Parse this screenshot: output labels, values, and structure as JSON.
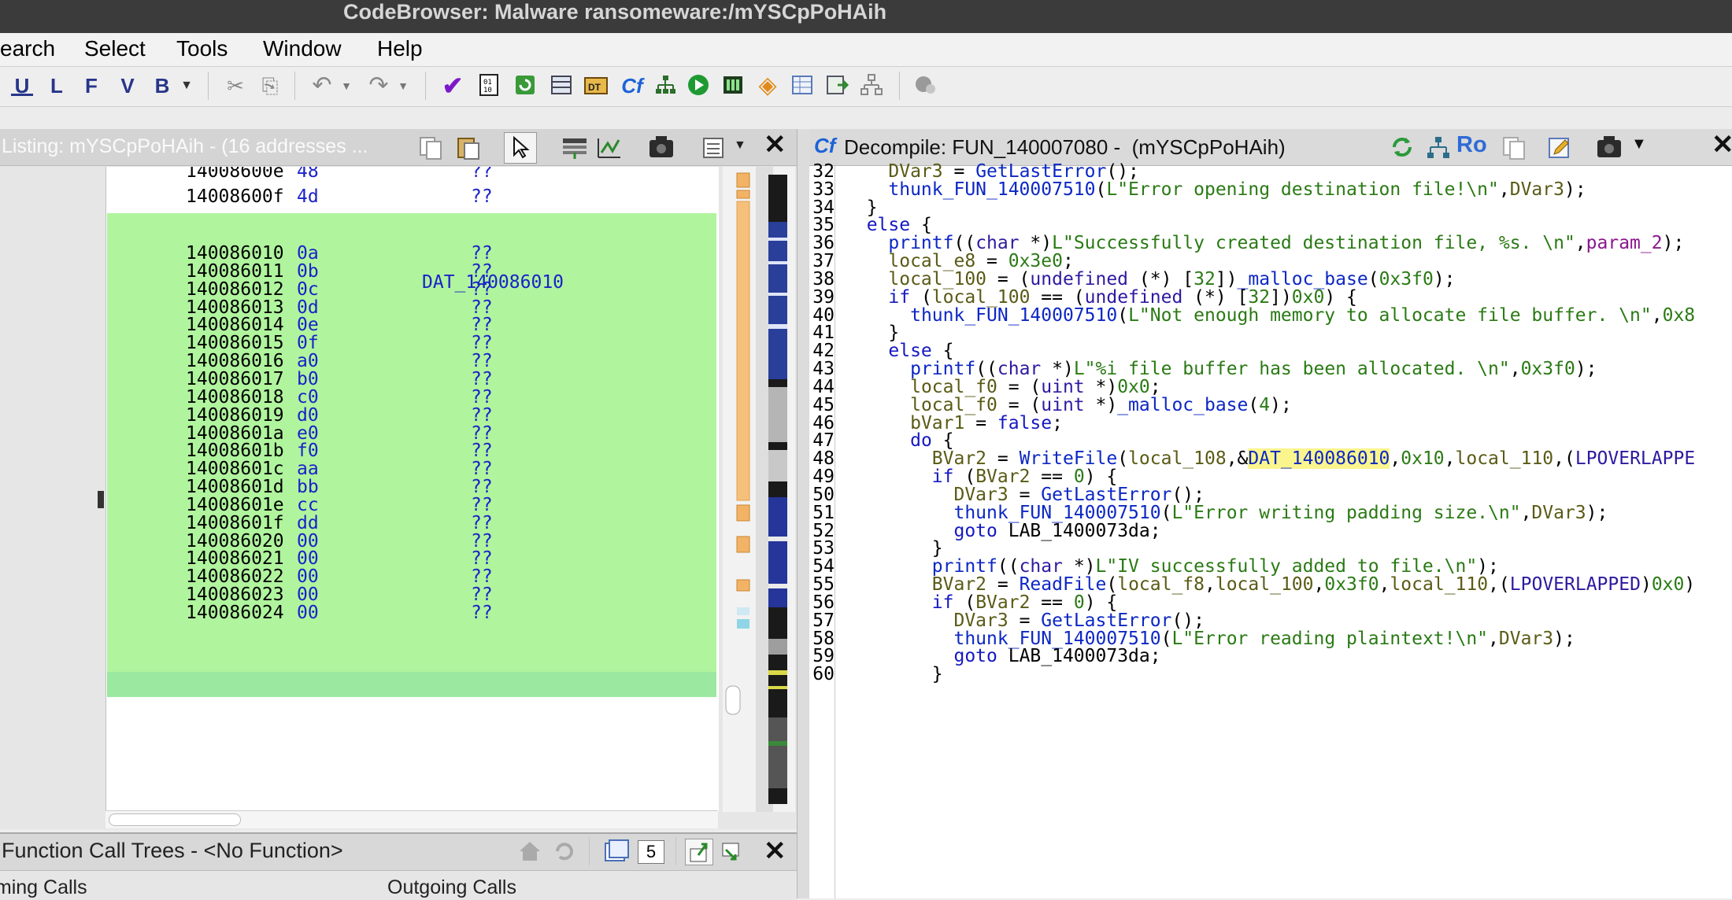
{
  "window": {
    "title": "CodeBrowser: Malware ransomeware:/mYSCpPoHAih"
  },
  "menu": [
    "earch",
    "Select",
    "Tools",
    "Window",
    "Help"
  ],
  "toolbar": {
    "letters": [
      "U",
      "L",
      "F",
      "V",
      "B"
    ]
  },
  "listing": {
    "title": "Listing:  mYSCpPoHAih - (16 addresses ...",
    "label": "DAT_140086010",
    "rows_top": [
      {
        "addr": "14008600e",
        "byte": "48",
        "q": "??"
      },
      {
        "addr": "14008600f",
        "byte": "4d",
        "q": "??"
      }
    ],
    "rows": [
      {
        "addr": "140086010",
        "byte": "0a",
        "q": "??"
      },
      {
        "addr": "140086011",
        "byte": "0b",
        "q": "??"
      },
      {
        "addr": "140086012",
        "byte": "0c",
        "q": "??"
      },
      {
        "addr": "140086013",
        "byte": "0d",
        "q": "??"
      },
      {
        "addr": "140086014",
        "byte": "0e",
        "q": "??"
      },
      {
        "addr": "140086015",
        "byte": "0f",
        "q": "??"
      },
      {
        "addr": "140086016",
        "byte": "a0",
        "q": "??"
      },
      {
        "addr": "140086017",
        "byte": "b0",
        "q": "??"
      },
      {
        "addr": "140086018",
        "byte": "c0",
        "q": "??"
      },
      {
        "addr": "140086019",
        "byte": "d0",
        "q": "??"
      },
      {
        "addr": "14008601a",
        "byte": "e0",
        "q": "??"
      },
      {
        "addr": "14008601b",
        "byte": "f0",
        "q": "??"
      },
      {
        "addr": "14008601c",
        "byte": "aa",
        "q": "??"
      },
      {
        "addr": "14008601d",
        "byte": "bb",
        "q": "??"
      },
      {
        "addr": "14008601e",
        "byte": "cc",
        "q": "??"
      },
      {
        "addr": "14008601f",
        "byte": "dd",
        "q": "??"
      },
      {
        "addr": "140086020",
        "byte": "00",
        "q": "??"
      },
      {
        "addr": "140086021",
        "byte": "00",
        "q": "??"
      },
      {
        "addr": "140086022",
        "byte": "00",
        "q": "??"
      },
      {
        "addr": "140086023",
        "byte": "00",
        "q": "??"
      },
      {
        "addr": "140086024",
        "byte": "00",
        "q": "??"
      }
    ]
  },
  "fct": {
    "title": "Function Call Trees - <No Function>",
    "count": "5",
    "incoming": "oming Calls",
    "outgoing": "Outgoing Calls"
  },
  "decompile": {
    "title": "Decompile: FUN_140007080 -  (mYSCpPoHAih)",
    "ro": "Ro",
    "line_numbers": [
      "32",
      "33",
      "34",
      "35",
      "36",
      "37",
      "38",
      "39",
      "40",
      "41",
      "42",
      "43",
      "44",
      "45",
      "46",
      "47",
      "48",
      "49",
      "50",
      "51",
      "52",
      "53",
      "54",
      "55",
      "56",
      "57",
      "58",
      "59",
      "60"
    ],
    "code": [
      "    DVar3 = GetLastError();",
      "    thunk_FUN_140007510(L\"Error opening destination file!\\n\",DVar3);",
      "  }",
      "  else {",
      "    printf((char *)L\"Successfully created destination file, %s. \\n\",param_2);",
      "    local_e8 = 0x3e0;",
      "    local_100 = (undefined (*) [32])_malloc_base(0x3f0);",
      "    if (local_100 == (undefined (*) [32])0x0) {",
      "      thunk_FUN_140007510(L\"Not enough memory to allocate file buffer. \\n\",0x8",
      "    }",
      "    else {",
      "      printf((char *)L\"%i file buffer has been allocated. \\n\",0x3f0);",
      "      local_f0 = (uint *)0x0;",
      "      local_f0 = (uint *)_malloc_base(4);",
      "      bVar1 = false;",
      "      do {",
      "        BVar2 = WriteFile(local_108,&DAT_140086010,0x10,local_110,(LPOVERLAPPE",
      "        if (BVar2 == 0) {",
      "          DVar3 = GetLastError();",
      "          thunk_FUN_140007510(L\"Error writing padding size.\\n\",DVar3);",
      "          goto LAB_1400073da;",
      "        }",
      "        printf((char *)L\"IV successfully added to file.\\n\");",
      "        BVar2 = ReadFile(local_f8,local_100,0x3f0,local_110,(LPOVERLAPPED)0x0)",
      "        if (BVar2 == 0) {",
      "          DVar3 = GetLastError();",
      "          thunk_FUN_140007510(L\"Error reading plaintext!\\n\",DVar3);",
      "          goto LAB_1400073da;",
      "        }"
    ]
  }
}
